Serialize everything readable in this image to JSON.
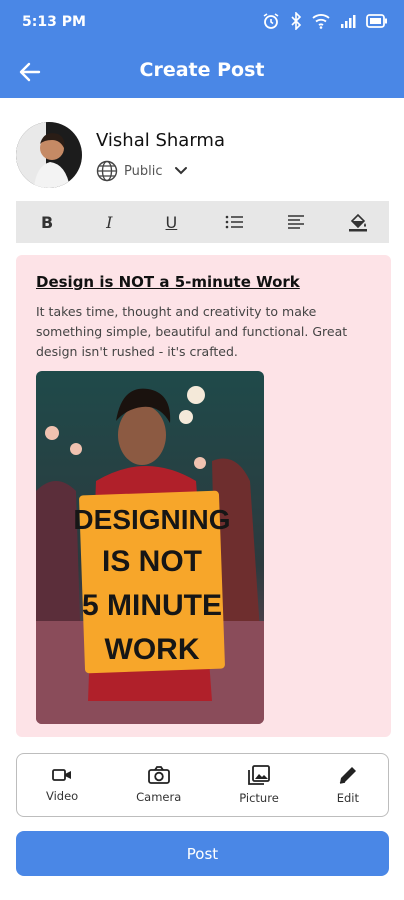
{
  "status_bar": {
    "time": "5:13 PM",
    "icons": [
      "alarm-icon",
      "bluetooth-icon",
      "wifi-icon",
      "signal-icon",
      "battery-icon"
    ]
  },
  "app_bar": {
    "title": "Create Post",
    "back_icon": "arrow-left-icon"
  },
  "user": {
    "name": "Vishal Sharma",
    "privacy": "Public"
  },
  "toolbar": {
    "items": [
      {
        "name": "bold",
        "glyph": "B"
      },
      {
        "name": "italic",
        "glyph": "I"
      },
      {
        "name": "underline",
        "glyph": "U"
      },
      {
        "name": "bullet-list",
        "glyph": ""
      },
      {
        "name": "align-left",
        "glyph": ""
      },
      {
        "name": "fill-color",
        "glyph": ""
      }
    ]
  },
  "post": {
    "heading": "Design is NOT a 5-minute Work",
    "body": "It takes time, thought and creativity to make something simple, beautiful and functional. Great design isn't rushed - it's crafted.",
    "image_sign_lines": [
      "DESIGNING",
      "IS NOT",
      "5 MINUTE",
      "WORK"
    ]
  },
  "actions": [
    {
      "label": "Video",
      "icon": "video-camera-icon"
    },
    {
      "label": "Camera",
      "icon": "camera-icon"
    },
    {
      "label": "Picture",
      "icon": "image-icon"
    },
    {
      "label": "Edit",
      "icon": "pencil-icon"
    }
  ],
  "post_button": {
    "label": "Post"
  },
  "colors": {
    "primary": "#4a87e6",
    "card_bg": "#fde3e7",
    "toolbar_bg": "#e7e7e7",
    "sign": "#f7a62a"
  }
}
